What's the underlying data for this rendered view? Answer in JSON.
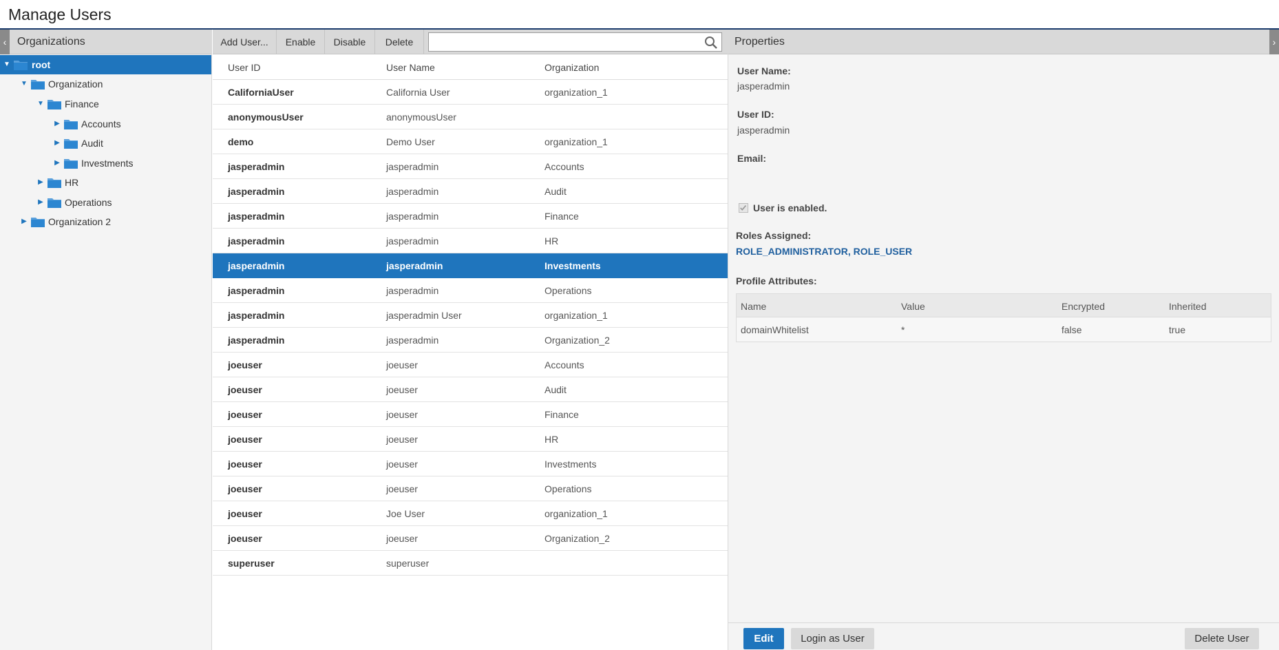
{
  "page": {
    "title": "Manage Users"
  },
  "left_panel": {
    "title": "Organizations",
    "collapse_glyph": "‹",
    "tree": [
      {
        "label": "root",
        "expanded": true,
        "selected": true
      },
      {
        "label": "Organization",
        "expanded": true
      },
      {
        "label": "Finance",
        "expanded": true
      },
      {
        "label": "Accounts",
        "expanded": false
      },
      {
        "label": "Audit",
        "expanded": false
      },
      {
        "label": "Investments",
        "expanded": false
      },
      {
        "label": "HR",
        "expanded": false
      },
      {
        "label": "Operations",
        "expanded": false
      },
      {
        "label": "Organization 2",
        "expanded": false
      }
    ]
  },
  "toolbar": {
    "add_label": "Add User...",
    "enable_label": "Enable",
    "disable_label": "Disable",
    "delete_label": "Delete",
    "search_value": "",
    "search_placeholder": ""
  },
  "users_table": {
    "columns": [
      "User ID",
      "User Name",
      "Organization"
    ],
    "rows": [
      [
        "CaliforniaUser",
        "California User",
        "organization_1"
      ],
      [
        "anonymousUser",
        "anonymousUser",
        ""
      ],
      [
        "demo",
        "Demo User",
        "organization_1"
      ],
      [
        "jasperadmin",
        "jasperadmin",
        "Accounts"
      ],
      [
        "jasperadmin",
        "jasperadmin",
        "Audit"
      ],
      [
        "jasperadmin",
        "jasperadmin",
        "Finance"
      ],
      [
        "jasperadmin",
        "jasperadmin",
        "HR"
      ],
      [
        "jasperadmin",
        "jasperadmin",
        "Investments"
      ],
      [
        "jasperadmin",
        "jasperadmin",
        "Operations"
      ],
      [
        "jasperadmin",
        "jasperadmin User",
        "organization_1"
      ],
      [
        "jasperadmin",
        "jasperadmin",
        "Organization_2"
      ],
      [
        "joeuser",
        "joeuser",
        "Accounts"
      ],
      [
        "joeuser",
        "joeuser",
        "Audit"
      ],
      [
        "joeuser",
        "joeuser",
        "Finance"
      ],
      [
        "joeuser",
        "joeuser",
        "HR"
      ],
      [
        "joeuser",
        "joeuser",
        "Investments"
      ],
      [
        "joeuser",
        "joeuser",
        "Operations"
      ],
      [
        "joeuser",
        "Joe User",
        "organization_1"
      ],
      [
        "joeuser",
        "joeuser",
        "Organization_2"
      ],
      [
        "superuser",
        "superuser",
        ""
      ]
    ],
    "selected_row": 7
  },
  "properties": {
    "title": "Properties",
    "expand_glyph": "›",
    "user_name_label": "User Name:",
    "user_name_value": "jasperadmin",
    "user_id_label": "User ID:",
    "user_id_value": "jasperadmin",
    "email_label": "Email:",
    "email_value": "",
    "enabled_label": "User is enabled.",
    "enabled": true,
    "roles_label": "Roles Assigned:",
    "roles": "ROLE_ADMINISTRATOR, ROLE_USER",
    "profile_label": "Profile Attributes:",
    "attr_columns": [
      "Name",
      "Value",
      "Encrypted",
      "Inherited"
    ],
    "attr_rows": [
      [
        "domainWhitelist",
        "*",
        "false",
        "true"
      ]
    ]
  },
  "footer": {
    "edit_label": "Edit",
    "login_label": "Login as User",
    "delete_label": "Delete User"
  },
  "colors": {
    "accent": "#1f75bd",
    "header_rule": "#1a3a6b",
    "panel_bg": "#f4f4f4",
    "panel_head": "#d9d9d9"
  }
}
